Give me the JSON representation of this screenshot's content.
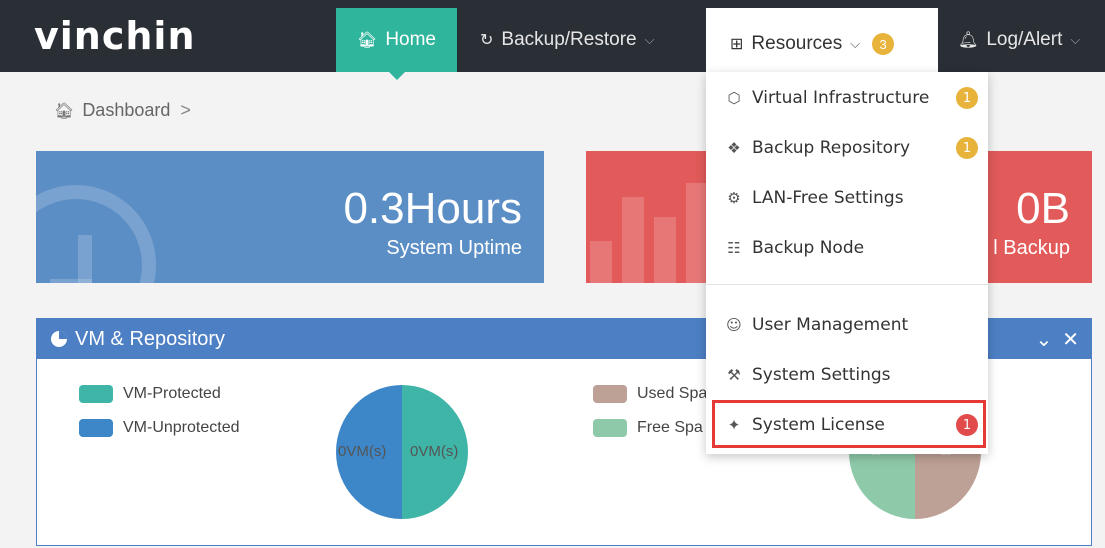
{
  "app": {
    "logo": "vinchin"
  },
  "nav": {
    "home": "Home",
    "backup": "Backup/Restore",
    "resources": "Resources",
    "resources_badge": "3",
    "log": "Log/Alert"
  },
  "breadcrumb": {
    "current": "Dashboard",
    "separator": ">"
  },
  "tiles": {
    "uptime": {
      "value": "0.3Hours",
      "label": "System Uptime"
    },
    "backup": {
      "value": "0B",
      "label": "l Backup"
    }
  },
  "panel": {
    "title": "VM & Repository",
    "legend_vm": [
      {
        "label": "VM-Protected",
        "color": "#3fb5a8"
      },
      {
        "label": "VM-Unprotected",
        "color": "#3d87c9"
      }
    ],
    "legend_repo": [
      {
        "label": "Used Spa",
        "color": "#bea196"
      },
      {
        "label": "Free Spa",
        "color": "#8ec9a9"
      }
    ],
    "pie_vm_left": "0VM(s)",
    "pie_vm_right": "0VM(s)",
    "pie_repo_left": "--",
    "pie_repo_right": "--"
  },
  "dropdown": {
    "items": [
      {
        "label": "Virtual Infrastructure",
        "badge": "1"
      },
      {
        "label": "Backup Repository",
        "badge": "1"
      },
      {
        "label": "LAN-Free Settings"
      },
      {
        "label": "Backup Node"
      },
      {
        "label": "User Management"
      },
      {
        "label": "System Settings"
      },
      {
        "label": "System License",
        "badge": "1"
      }
    ]
  },
  "colors": {
    "navbar": "#2a2f36",
    "home_accent": "#2fb59b",
    "tile_blue": "#5c8ec6",
    "tile_red": "#e25a5a",
    "panel_header": "#4d7fc4",
    "badge_yellow": "#e8b33a",
    "badge_red": "#e24b4b",
    "highlight": "#e53935"
  }
}
